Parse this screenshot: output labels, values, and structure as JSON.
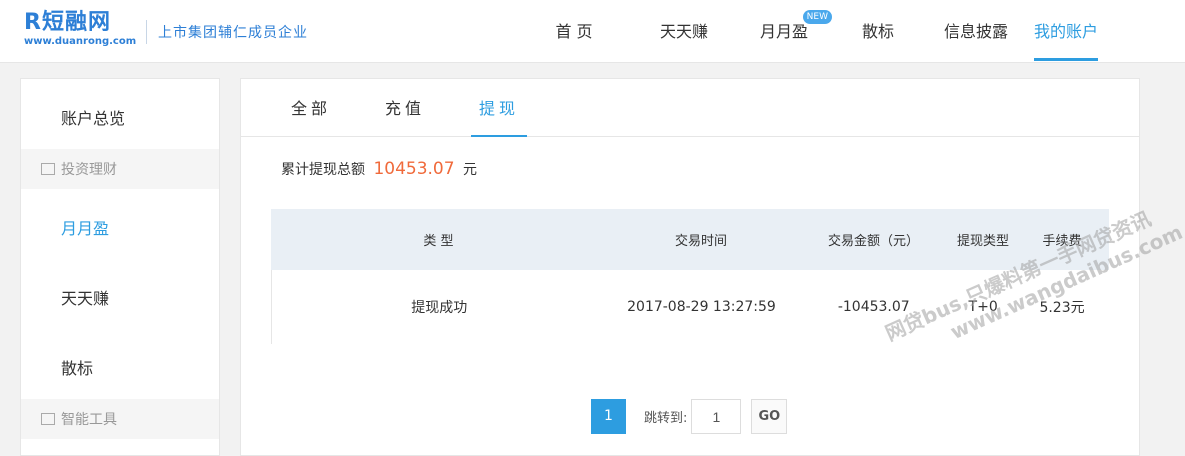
{
  "header": {
    "logo_text": "R短融网",
    "logo_url": "www.duanrong.com",
    "slogan": "上市集团辅仁成员企业",
    "nav": [
      {
        "label": "首 页"
      },
      {
        "label": "天天赚"
      },
      {
        "label": "月月盈",
        "badge": "NEW"
      },
      {
        "label": "散标"
      },
      {
        "label": "信息披露"
      },
      {
        "label": "我的账户",
        "active": true
      }
    ]
  },
  "sidebar": {
    "overview": "账户总览",
    "group_invest": "投资理财",
    "item_yueyueying": "月月盈",
    "item_tiantianzhuan": "天天赚",
    "item_sanbiao": "散标",
    "group_tools": "智能工具"
  },
  "tabs": [
    {
      "label": "全部"
    },
    {
      "label": "充值"
    },
    {
      "label": "提现",
      "active": true
    }
  ],
  "summary": {
    "label": "累计提现总额",
    "amount": "10453.07",
    "unit": "元"
  },
  "table": {
    "headers": [
      "类 型",
      "交易时间",
      "交易金额（元）",
      "提现类型",
      "手续费"
    ],
    "rows": [
      {
        "type": "提现成功",
        "time": "2017-08-29 13:27:59",
        "amount": "-10453.07",
        "withdraw_type": "T+0",
        "fee": "5.23元"
      }
    ]
  },
  "pager": {
    "current_page": "1",
    "jump_label": "跳转到:",
    "jump_value": "1",
    "go_label": "GO"
  },
  "watermark": {
    "line1": "网贷bus,只爆料第一手网贷资讯",
    "line2": "www.wangdaibus.com"
  }
}
